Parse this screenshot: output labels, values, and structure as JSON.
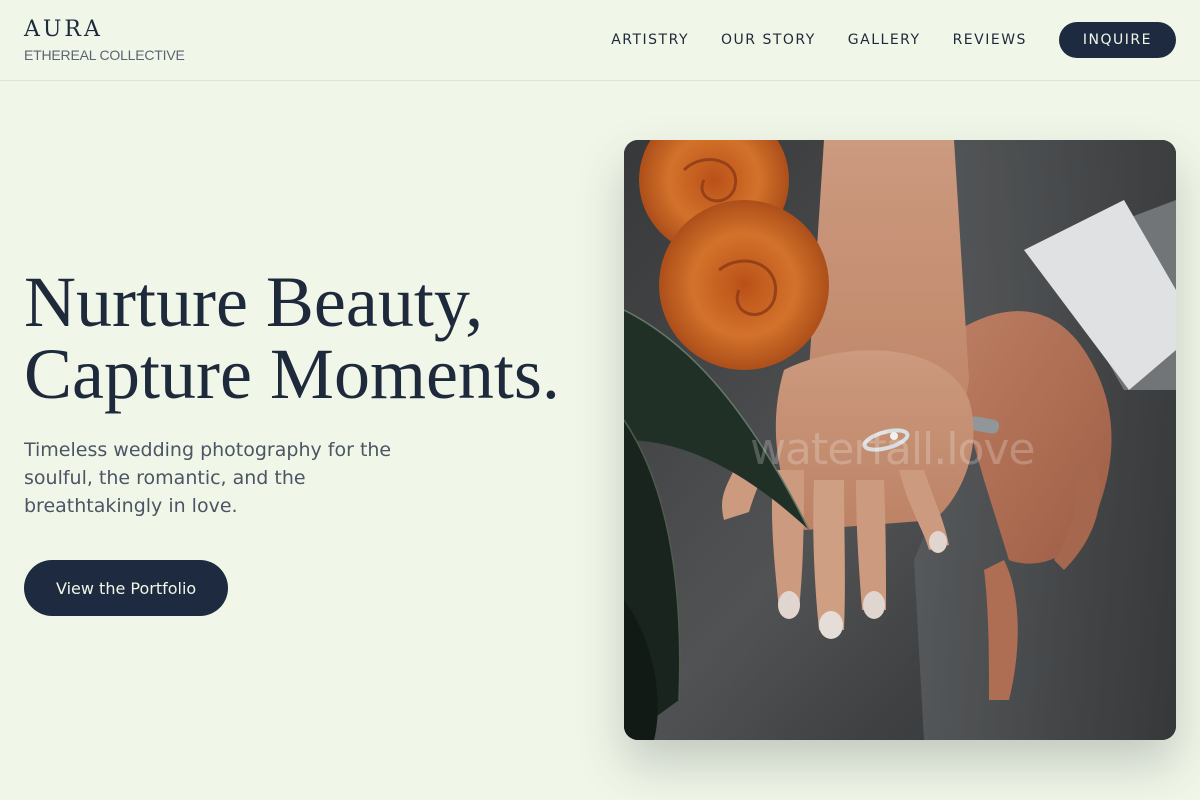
{
  "brand": {
    "name": "AURA",
    "tagline": "ETHEREAL COLLECTIVE"
  },
  "nav": {
    "links": [
      "ARTISTRY",
      "OUR STORY",
      "GALLERY",
      "REVIEWS"
    ],
    "cta_label": "INQUIRE"
  },
  "hero": {
    "title_line1": "Nurture Beauty,",
    "title_line2": "Capture Moments.",
    "subtitle": "Timeless wedding photography for the soulful, the romantic, and the breathtakingly in love.",
    "cta_label": "View the Portfolio"
  },
  "photo": {
    "watermark": "waterfall.love"
  },
  "colors": {
    "background": "#f1f7e8",
    "primary": "#1e2a40",
    "text": "#1e293b",
    "muted": "#4b5563",
    "accent_floral": "#e07a2e"
  }
}
